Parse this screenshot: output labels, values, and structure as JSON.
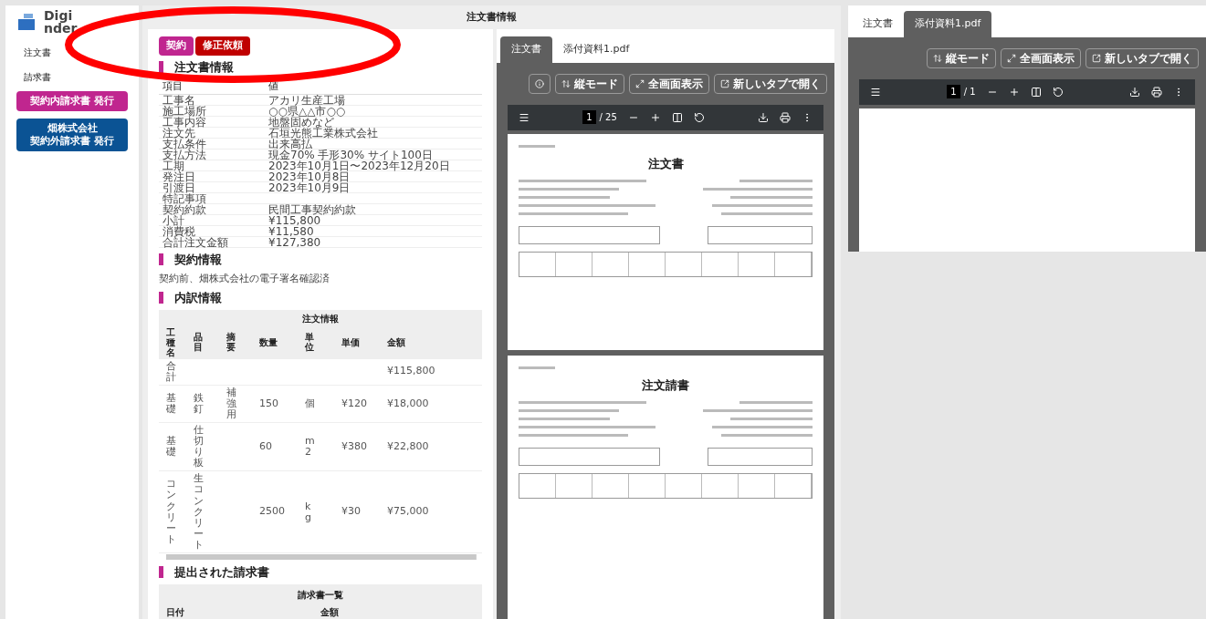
{
  "logo": {
    "line_1": "Digi",
    "line_2": "nder"
  },
  "sidebar": {
    "items": [
      {
        "label": "注文書"
      },
      {
        "label": "請求書"
      }
    ],
    "actions": [
      {
        "lines": [
          "契約内請求書 発行"
        ],
        "color": "#c0268f"
      },
      {
        "lines": [
          "畑株式会社",
          "契約外請求書 発行"
        ],
        "color": "#0b5394"
      }
    ]
  },
  "header": {
    "title": "注文書情報"
  },
  "badges": [
    {
      "label": "契約",
      "color": "#c0268f"
    },
    {
      "label": "修正依頼",
      "color": "#c00000"
    }
  ],
  "order_info": {
    "title": "注文書情報",
    "columns": [
      "項目",
      "値"
    ],
    "rows": [
      [
        "工事名",
        "アカリ生産工場"
      ],
      [
        "施工場所",
        "○○県△△市○○"
      ],
      [
        "工事内容",
        "地盤固めなど"
      ],
      [
        "注文先",
        "石垣光熊工業株式会社"
      ],
      [
        "支払条件",
        "出来高払"
      ],
      [
        "支払方法",
        "現金70% 手形30% サイト100日"
      ],
      [
        "工期",
        "2023年10月1日〜2023年12月20日"
      ],
      [
        "発注日",
        "2023年10月8日"
      ],
      [
        "引渡日",
        "2023年10月9日"
      ],
      [
        "特記事項",
        ""
      ],
      [
        "契約約款",
        "民間工事契約約款"
      ],
      [
        "小計",
        "¥115,800"
      ],
      [
        "消費税",
        "¥11,580"
      ],
      [
        "合計注文金額",
        "¥127,380"
      ]
    ]
  },
  "contract_info": {
    "title": "契約情報",
    "text": "契約前、畑株式会社の電子署名確認済"
  },
  "breakdown": {
    "title": "内訳情報",
    "caption": "注文情報",
    "columns": [
      "工種名",
      "品目",
      "摘要",
      "数量",
      "単位",
      "単価",
      "金額"
    ],
    "rows": [
      [
        "合計",
        "",
        "",
        "",
        "",
        "",
        "¥115,800"
      ],
      [
        "基礎",
        "鉄釘",
        "補強用",
        "150",
        "個",
        "¥120",
        "¥18,000"
      ],
      [
        "基礎",
        "仕切り板",
        "",
        "60",
        "m2",
        "¥380",
        "¥22,800"
      ],
      [
        "コンクリート",
        "生コンクリート",
        "",
        "2500",
        "kg",
        "¥30",
        "¥75,000"
      ]
    ]
  },
  "invoices": {
    "title": "提出された請求書",
    "caption": "請求書一覧",
    "columns": [
      "日付",
      "金額"
    ]
  },
  "viewers": [
    {
      "tabs": [
        {
          "label": "注文書",
          "selected": true
        },
        {
          "label": "添付資料1.pdf",
          "selected": false
        }
      ],
      "buttons": [
        {
          "kind": "info"
        },
        {
          "kind": "vertical",
          "label": "縦モード"
        },
        {
          "kind": "fullscreen",
          "label": "全画面表示"
        },
        {
          "kind": "newtab",
          "label": "新しいタブで開く"
        }
      ],
      "page": "1",
      "pages": "/ 25",
      "documents": [
        {
          "kind": "order",
          "title": "注文書"
        },
        {
          "kind": "order",
          "title": "注文請書"
        }
      ]
    },
    {
      "tabs": [
        {
          "label": "注文書",
          "selected": false
        },
        {
          "label": "添付資料1.pdf",
          "selected": true
        }
      ],
      "buttons": [
        {
          "kind": "vertical",
          "label": "縦モード"
        },
        {
          "kind": "fullscreen",
          "label": "全画面表示"
        },
        {
          "kind": "newtab",
          "label": "新しいタブで開く"
        }
      ],
      "page": "1",
      "pages": "/ 1",
      "documents": [
        {
          "kind": "blank"
        }
      ]
    }
  ],
  "annotation": {
    "kind": "ellipse",
    "color": "#ff0000"
  }
}
